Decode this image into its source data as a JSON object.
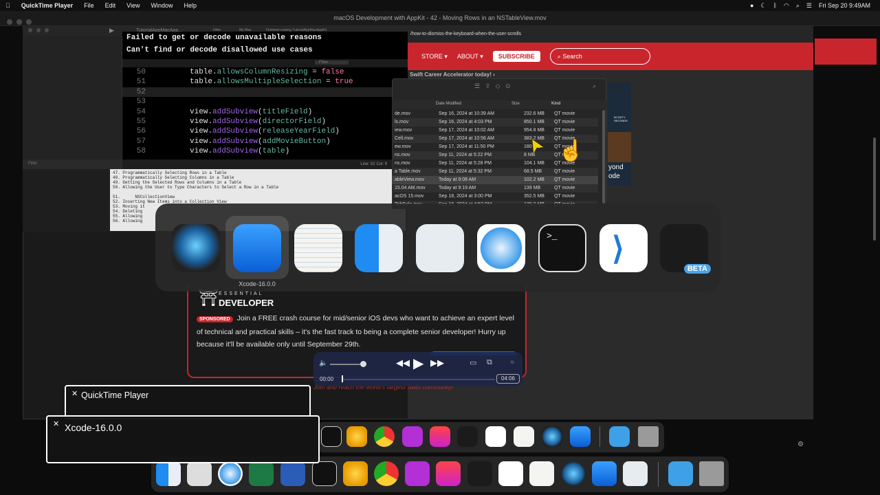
{
  "menubar": {
    "apple": "",
    "app": "QuickTime Player",
    "items": [
      "File",
      "Edit",
      "View",
      "Window",
      "Help"
    ],
    "datetime": "Fri Sep 20  9:49AM"
  },
  "window": {
    "title": "macOS Development with AppKit - 42 - Moving Rows in an NSTableView.mov"
  },
  "xcode": {
    "tabs": [
      "TutorialAppMacApp...",
      "Filter",
      "My Mac",
      "Finished running TutorialAppMacAppKit"
    ],
    "errors": [
      "Failed to get or decode unavailable reasons",
      "Can't find or decode disallowed use cases"
    ],
    "filter_placeholder": "Filter",
    "status": "Line: 52  Col: 9",
    "code": [
      {
        "n": "50",
        "parts": [
          [
            "",
            "table."
          ],
          [
            "mth",
            "allowsColumnResizing"
          ],
          [
            "",
            " = "
          ],
          [
            "kw",
            "false"
          ]
        ]
      },
      {
        "n": "51",
        "parts": [
          [
            "",
            "table."
          ],
          [
            "mth",
            "allowsMultipleSelection"
          ],
          [
            "",
            " = "
          ],
          [
            "kw",
            "true"
          ]
        ]
      },
      {
        "n": "52",
        "parts": []
      },
      {
        "n": "53",
        "parts": []
      },
      {
        "n": "54",
        "parts": [
          [
            "",
            "view."
          ],
          [
            "fn",
            "addSubview"
          ],
          [
            "",
            "("
          ],
          [
            "mth",
            "titleField"
          ],
          [
            "",
            ")"
          ]
        ]
      },
      {
        "n": "55",
        "parts": [
          [
            "",
            "view."
          ],
          [
            "fn",
            "addSubview"
          ],
          [
            "",
            "("
          ],
          [
            "mth",
            "directorField"
          ],
          [
            "",
            ")"
          ]
        ]
      },
      {
        "n": "56",
        "parts": [
          [
            "",
            "view."
          ],
          [
            "fn",
            "addSubview"
          ],
          [
            "",
            "("
          ],
          [
            "mth",
            "releaseYearField"
          ],
          [
            "",
            ")"
          ]
        ]
      },
      {
        "n": "57",
        "parts": [
          [
            "",
            "view."
          ],
          [
            "fn",
            "addSubview"
          ],
          [
            "",
            "("
          ],
          [
            "mth",
            "addMovieButton"
          ],
          [
            "",
            ")"
          ]
        ]
      },
      {
        "n": "58",
        "parts": [
          [
            "",
            "view."
          ],
          [
            "fn",
            "addSubview"
          ],
          [
            "",
            "("
          ],
          [
            "mth",
            "table"
          ],
          [
            "",
            ")"
          ]
        ]
      }
    ],
    "outline": [
      "47. Programmatically Selecting Rows in a Table",
      "48. Programmatically Selecting Columns in a Table",
      "49. Getting the Selected Rows and Columns in a Table",
      "50. Allowing the User to Type Characters to Select a Row in a Table",
      "",
      "51.      NSCollectionView",
      "52. Inserting New Items into a Collection View",
      "53. Moving it",
      "54. Deleting",
      "55. Allowing",
      "56. Allowing"
    ]
  },
  "browser": {
    "url": "/how-to-dismiss-the-keyboard-when-the-user-scrolls",
    "nav": [
      "STORE ▾",
      "ABOUT ▾"
    ],
    "subscribe": "SUBSCRIBE",
    "search": "Search",
    "promo_snippet": "Swift Career Accelerator today! ›"
  },
  "finder": {
    "columns": [
      "Date Modified",
      "Size",
      "Kind"
    ],
    "rows": [
      [
        "de.mov",
        "Sep 16, 2024 at 10:39 AM",
        "232.6 MB",
        "QT movie"
      ],
      [
        "ls.mov",
        "Sep 16, 2024 at 4:03 PM",
        "850.1 MB",
        "QT movie"
      ],
      [
        "iew.mov",
        "Sep 17, 2024 at 10:02 AM",
        "954.8 MB",
        "QT movie"
      ],
      [
        "Cell.mov",
        "Sep 17, 2024 at 10:56 AM",
        "383.2 MB",
        "QT movie"
      ],
      [
        "ew.mov",
        "Sep 17, 2024 at 11:50 PM",
        "180 MB",
        "QT movie"
      ],
      [
        "ns.mov",
        "Sep 11, 2024 at 5:22 PM",
        "8 MB",
        "QT movie"
      ],
      [
        "ns.mov",
        "Sep 11, 2024 at 5:28 PM",
        "104.1 MB",
        "QT movie"
      ],
      [
        "a Table.mov",
        "Sep 11, 2024 at 5:32 PM",
        "68.5 MB",
        "QT movie"
      ],
      [
        "ableView.mov",
        "Today at 9:08 AM",
        "102.2 MB",
        "QT movie"
      ],
      [
        "15.04 AM.mov",
        "Today at 9:19 AM",
        "139 MB",
        "QT movie"
      ],
      [
        "acOS 15.mov",
        "Sep 18, 2024 at 3:00 PM",
        "352.5 MB",
        "QT movie"
      ],
      [
        "TabBele.mov",
        "Sep 18, 2024 at 4:53 PM",
        "129.2 MB",
        "QT movie"
      ]
    ],
    "thumb_labels": [
      "IN SIXTY SECONDS",
      "yond",
      "ode"
    ]
  },
  "switcher": {
    "apps": [
      "quicktime-icon",
      "xcode-icon",
      "textedit-icon",
      "finder-icon",
      "preview-icon",
      "safari-icon",
      "terminal-icon",
      "vscode-icon",
      "swift-playgrounds-beta-icon"
    ],
    "selected_label": "Xcode-16.0.0",
    "beta": "BETA",
    "terminal_glyph": ">_"
  },
  "ad": {
    "brand_top": "ESSENTIAL",
    "brand": "DEVELOPER",
    "badge": "SPONSORED",
    "text": "Join a FREE crash course for mid/senior iOS devs who want to achieve an expert level of technical and practical skills – it's the fast track to being a complete senior developer! Hurry up because it'll be available only until September 29th.",
    "tail": "Join and reach the world's largest Swift community!"
  },
  "player": {
    "elapsed": "00:00",
    "remaining": "04:06",
    "volume_fraction": 0.9,
    "progress_fraction": 0.0
  },
  "notifications": [
    {
      "close": "✕",
      "title": "QuickTime Player"
    },
    {
      "close": "✕",
      "title": "Xcode-16.0.0"
    }
  ],
  "colors": {
    "brand_red": "#c9252d",
    "keyword": "#ff7ab2",
    "method": "#67b7a4",
    "function": "#a167e6"
  }
}
